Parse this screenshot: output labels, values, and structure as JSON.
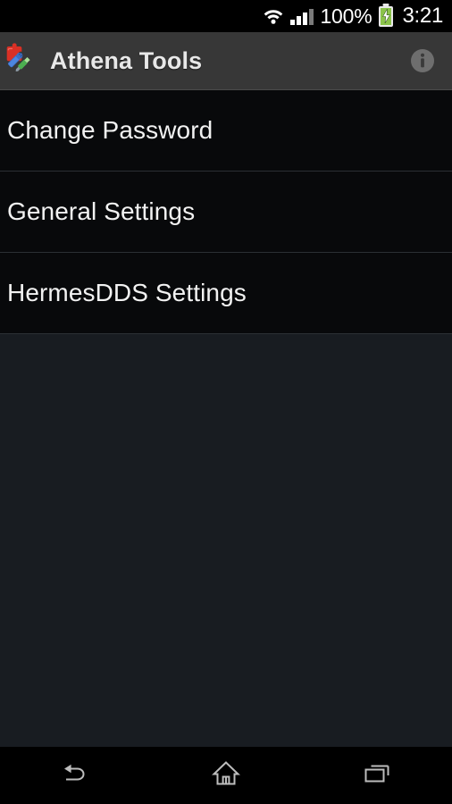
{
  "status_bar": {
    "wifi_icon": "wifi-icon",
    "signal_icon": "signal-bars-icon",
    "battery_percent": "100%",
    "battery_icon": "battery-charging-icon",
    "time": "3:21"
  },
  "action_bar": {
    "app_icon": "puzzle-wrench-screwdriver-icon",
    "title": "Athena Tools",
    "info_icon": "info-icon"
  },
  "list": {
    "items": [
      {
        "label": "Change Password"
      },
      {
        "label": "General Settings"
      },
      {
        "label": "HermesDDS Settings"
      }
    ]
  },
  "nav_bar": {
    "back_icon": "back-arrow-icon",
    "home_icon": "home-icon",
    "recents_icon": "recent-apps-icon"
  },
  "colors": {
    "action_bar_bg": "#373737",
    "list_item_bg": "#08090b",
    "page_bg": "#181c21",
    "divider": "#2b2f34",
    "text_primary": "#f2f2f2",
    "battery_green": "#8bc34a"
  }
}
